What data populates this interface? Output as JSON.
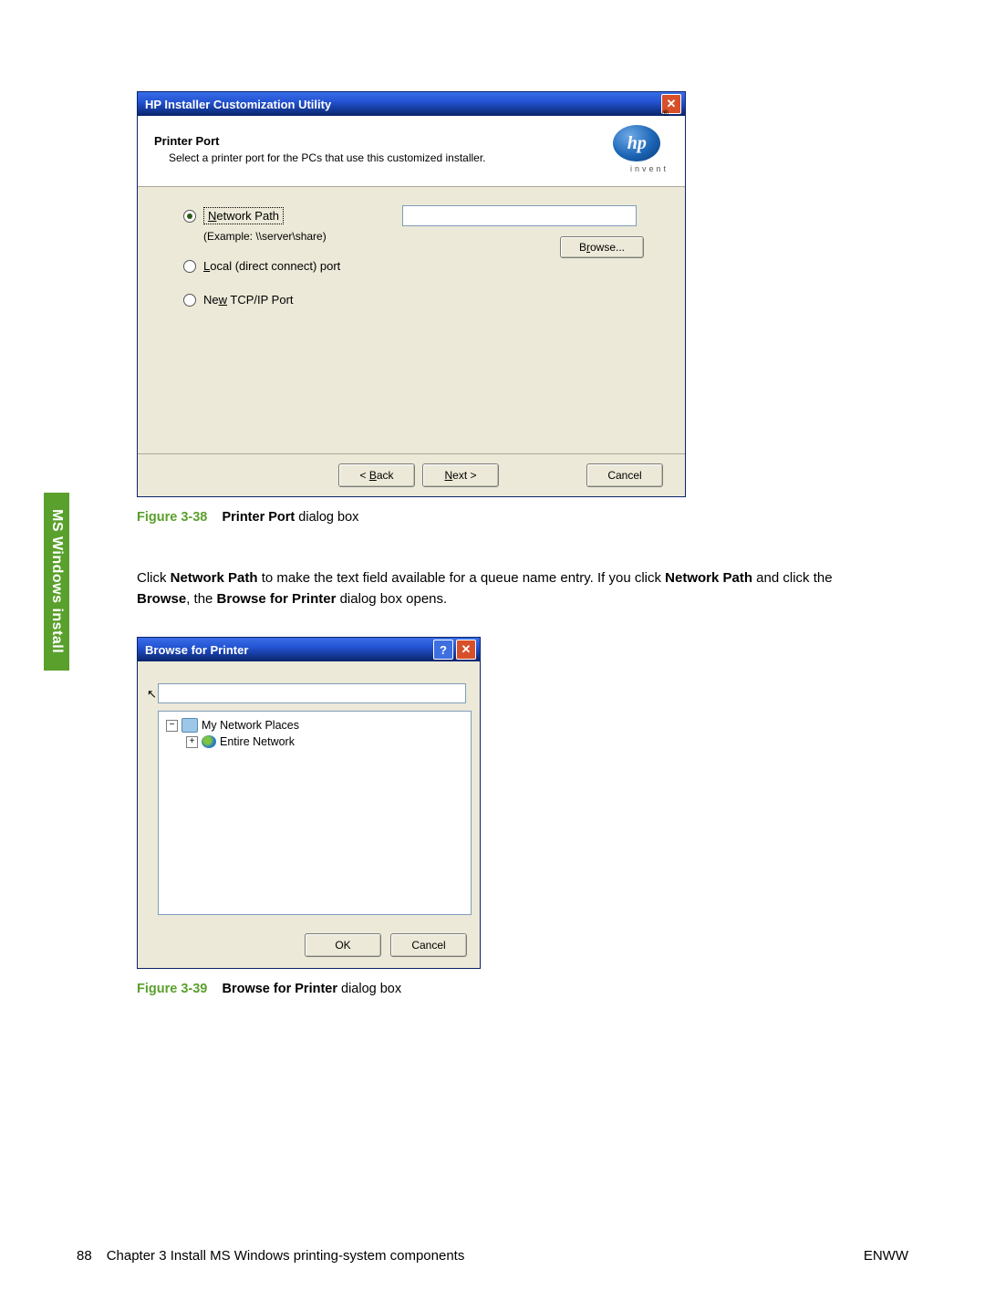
{
  "sidebar_tab": "MS Windows install",
  "dialog1": {
    "title": "HP Installer Customization Utility",
    "header_title": "Printer Port",
    "header_sub": "Select a printer port for the PCs that use this customized installer.",
    "logo_text": "hp",
    "logo_sub": "invent",
    "reg": "®",
    "options": {
      "network_path": "Network Path",
      "example": "(Example:  \\\\server\\share)",
      "local": "Local (direct connect) port",
      "tcpip": "New TCP/IP Port"
    },
    "browse": "Browse...",
    "back": "< Back",
    "next": "Next >",
    "cancel": "Cancel"
  },
  "caption1": {
    "fig": "Figure 3-38",
    "bold": "Printer Port",
    "rest": " dialog box"
  },
  "paragraph": {
    "p1a": "Click ",
    "p1b": "Network Path",
    "p1c": " to make the text field available for a queue name entry. If you click ",
    "p1d": "Network Path",
    "p1e": " and click the ",
    "p1f": "Browse",
    "p1g": ", the ",
    "p1h": "Browse for Printer",
    "p1i": " dialog box opens."
  },
  "dialog2": {
    "title": "Browse for Printer",
    "tree": {
      "root": "My Network Places",
      "child": "Entire Network"
    },
    "ok": "OK",
    "cancel": "Cancel"
  },
  "caption2": {
    "fig": "Figure 3-39",
    "bold": "Browse for Printer",
    "rest": " dialog box"
  },
  "footer": {
    "page": "88",
    "chapter": "Chapter 3   Install MS Windows printing-system components",
    "right": "ENWW"
  }
}
